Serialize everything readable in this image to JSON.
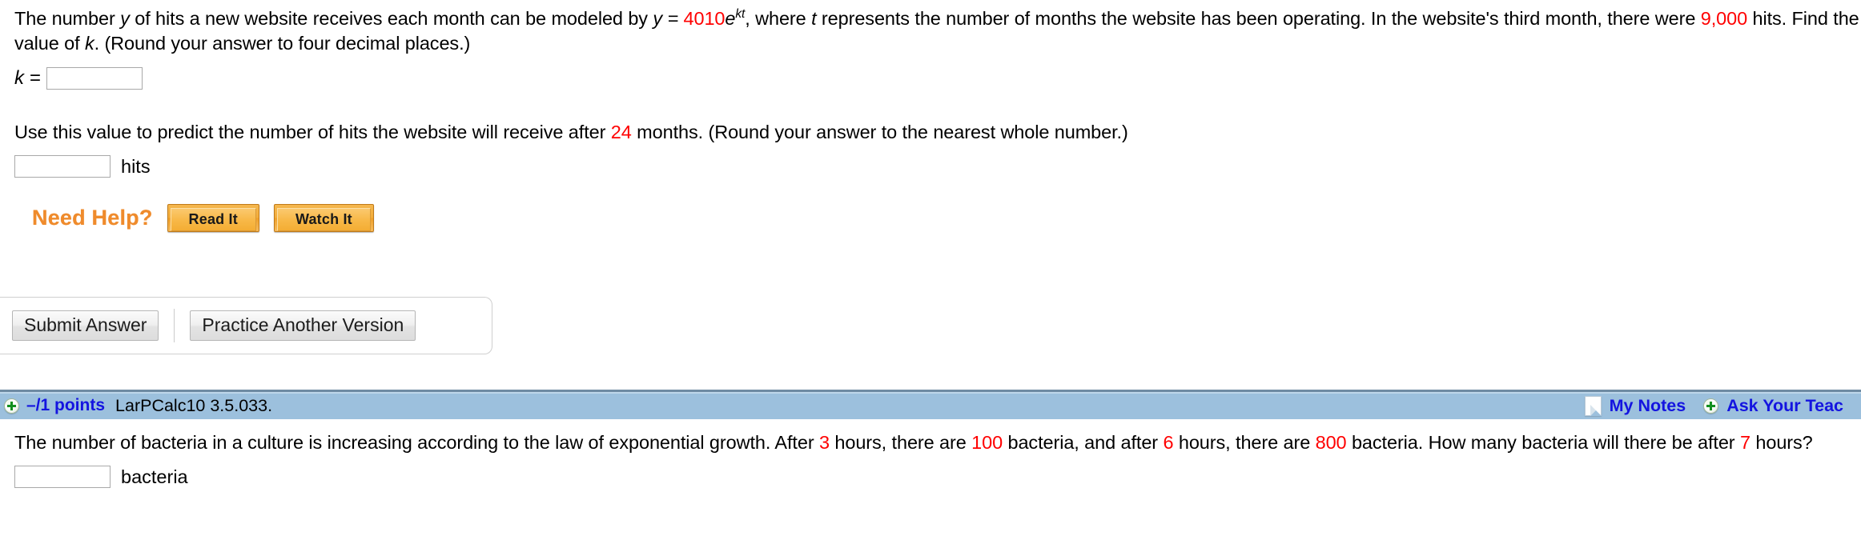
{
  "problem1": {
    "text_before_eq": "The number ",
    "var_y": "y",
    "text_mid1": " of hits a new website receives each month can be modeled by  ",
    "equation": {
      "lhs": "y",
      "eq": " = ",
      "coefficient": "4010",
      "base": "e",
      "exponent": "kt",
      "comma": ","
    },
    "text_mid2": "  where ",
    "var_t": "t",
    "text_mid3": " represents the number of months the website has been operating. In the website's third month, there were ",
    "hits_value": "9,000",
    "text_after": " hits. Find the value of ",
    "var_k": "k",
    "text_end": ". (Round your answer to four decimal places.)",
    "answer_label": "k =",
    "answer_value": "",
    "part2_before": "Use this value to predict the number of hits the website will receive after ",
    "part2_months": "24",
    "part2_after": " months. (Round your answer to the nearest whole number.)",
    "part2_value": "",
    "part2_unit": "hits"
  },
  "need_help": {
    "label": "Need Help?",
    "buttons": [
      {
        "label": "Read It",
        "name": "read-it-button"
      },
      {
        "label": "Watch It",
        "name": "watch-it-button"
      }
    ]
  },
  "submit_panel": {
    "submit_label": "Submit Answer",
    "practice_label": "Practice Another Version"
  },
  "question_header": {
    "plus_icon": "plus-circle-icon",
    "points": "–/1 points",
    "question_id": "LarPCalc10 3.5.033.",
    "notes_icon": "note-page-icon",
    "notes_label": "My Notes",
    "ask_plus_icon": "plus-circle-icon",
    "ask_label": "Ask Your Teac"
  },
  "problem2": {
    "text_before": "The number of bacteria in a culture is increasing according to the law of exponential growth. After ",
    "hours1": "3",
    "text_mid1": " hours, there are ",
    "bacteria1": "100",
    "text_mid2": " bacteria, and after ",
    "hours2": "6",
    "text_mid3": " hours, there are ",
    "bacteria2": "800",
    "text_mid4": " bacteria. How many bacteria will there be after ",
    "hours3": "7",
    "text_end": " hours?",
    "answer_value": "",
    "answer_unit": "bacteria"
  },
  "colors": {
    "red_value": "#ff0000",
    "link_blue": "#1414e0",
    "bar_blue": "#9cc0dd",
    "help_orange": "#ef8b2c",
    "plus_green": "#13901f"
  }
}
